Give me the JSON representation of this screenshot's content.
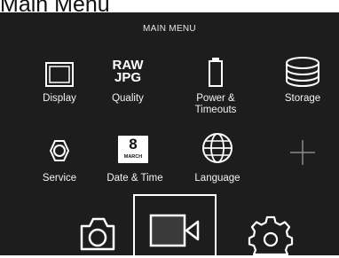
{
  "page": {
    "title": "Main Menu"
  },
  "menu": {
    "title": "MAIN MENU",
    "items": [
      {
        "label": "Display",
        "icon": "display-icon"
      },
      {
        "label": "Quality",
        "icon": "raw-jpg-icon",
        "icon_text_1": "RAW",
        "icon_text_2": "JPG"
      },
      {
        "label": "Power &\nTimeouts",
        "icon": "battery-icon"
      },
      {
        "label": "Storage",
        "icon": "storage-icon"
      },
      {
        "label": "Service",
        "icon": "hex-nut-icon"
      },
      {
        "label": "Date & Time",
        "icon": "calendar-icon",
        "icon_day": "8",
        "icon_month": "MARCH"
      },
      {
        "label": "Language",
        "icon": "globe-icon"
      },
      {
        "label": "",
        "icon": "plus-icon"
      }
    ]
  },
  "nav": [
    {
      "icon": "camera-icon"
    },
    {
      "icon": "video-camera-icon",
      "selected": true
    },
    {
      "icon": "settings-gear-icon"
    }
  ],
  "colors": {
    "background": "#1d1d1d",
    "foreground": "#ffffff",
    "muted": "#8a8a8a"
  }
}
